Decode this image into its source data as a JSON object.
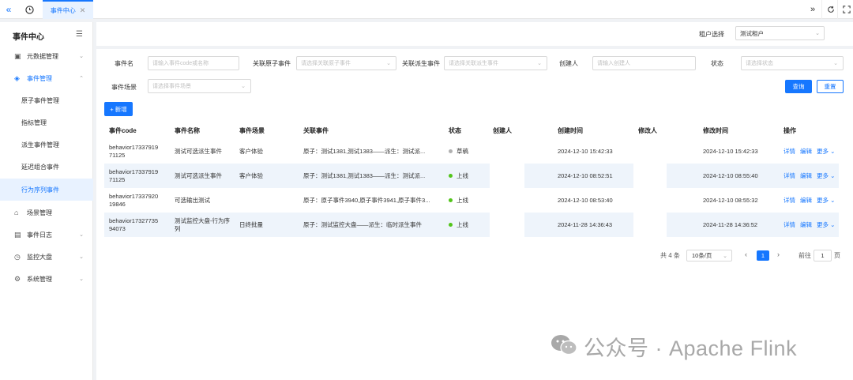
{
  "topbar": {
    "tab_label": "事件中心",
    "tab_close": "✕"
  },
  "sidebar": {
    "title": "事件中心",
    "items": [
      {
        "label": "元数据管理",
        "icon": "database-icon"
      },
      {
        "label": "事件管理",
        "icon": "layers-icon"
      },
      {
        "label": "场景管理",
        "icon": "home-icon"
      },
      {
        "label": "事件日志",
        "icon": "file-icon"
      },
      {
        "label": "监控大盘",
        "icon": "clock-icon"
      },
      {
        "label": "系统管理",
        "icon": "gear-icon"
      }
    ],
    "sub_items": [
      "原子事件管理",
      "指标管理",
      "派生事件管理",
      "延迟组合事件",
      "行为序列事件"
    ],
    "active_sub": "行为序列事件"
  },
  "tenant": {
    "label": "租户选择",
    "value": "测试租户"
  },
  "filters": {
    "event_name": {
      "label": "事件名",
      "placeholder": "请输入事件code或名称"
    },
    "atomic": {
      "label": "关联原子事件",
      "placeholder": "请选择关联原子事件"
    },
    "derived": {
      "label": "关联派生事件",
      "placeholder": "请选择关联派生事件"
    },
    "creator": {
      "label": "创建人",
      "placeholder": "请输入创建人"
    },
    "status": {
      "label": "状态",
      "placeholder": "请选择状态"
    },
    "scene": {
      "label": "事件场景",
      "placeholder": "请选择事件场景"
    }
  },
  "buttons": {
    "query": "查询",
    "reset": "重置",
    "add": "+ 新增"
  },
  "table": {
    "headers": [
      "事件code",
      "事件名称",
      "事件场景",
      "关联事件",
      "状态",
      "创建人",
      "创建时间",
      "修改人",
      "修改时间",
      "操作"
    ],
    "rows": [
      {
        "code": "behavior17337919 71125",
        "name": "测试可选派生事件",
        "scene": "客户体验",
        "related": "原子：测试1381,测试1383——派生：测试派...",
        "status": "草稿",
        "status_color": "#b0b0b0",
        "creator": "",
        "created": "2024-12-10 15:42:33",
        "modifier": "",
        "modified": "2024-12-10 15:42:33"
      },
      {
        "code": "behavior17337919 71125",
        "name": "测试可选派生事件",
        "scene": "客户体验",
        "related": "原子：测试1381,测试1383——派生：测试派...",
        "status": "上线",
        "status_color": "#52c41a",
        "creator": "",
        "created": "2024-12-10 08:52:51",
        "modifier": "",
        "modified": "2024-12-10 08:55:40"
      },
      {
        "code": "behavior17337920 19846",
        "name": "可选输出测试",
        "scene": "",
        "related": "原子：原子事件3940,原子事件3941,原子事件3...",
        "status": "上线",
        "status_color": "#52c41a",
        "creator": "",
        "created": "2024-12-10 08:53:40",
        "modifier": "",
        "modified": "2024-12-10 08:55:32"
      },
      {
        "code": "behavior17327735 94073",
        "name": "测试监控大盘-行为序列",
        "scene": "日终批量",
        "related": "原子：测试监控大盘——派生：临时派生事件",
        "status": "上线",
        "status_color": "#52c41a",
        "creator": "",
        "created": "2024-11-28 14:36:43",
        "modifier": "",
        "modified": "2024-11-28 14:36:52"
      }
    ],
    "actions": {
      "detail": "详情",
      "edit": "编辑",
      "more": "更多"
    }
  },
  "pagination": {
    "total": "共 4 条",
    "page_size": "10条/页",
    "prev": "‹",
    "current": "1",
    "next": "›",
    "goto_label": "前往",
    "goto_value": "1",
    "page_suffix": "页"
  },
  "watermark": {
    "text": "公众号 · Apache Flink"
  }
}
